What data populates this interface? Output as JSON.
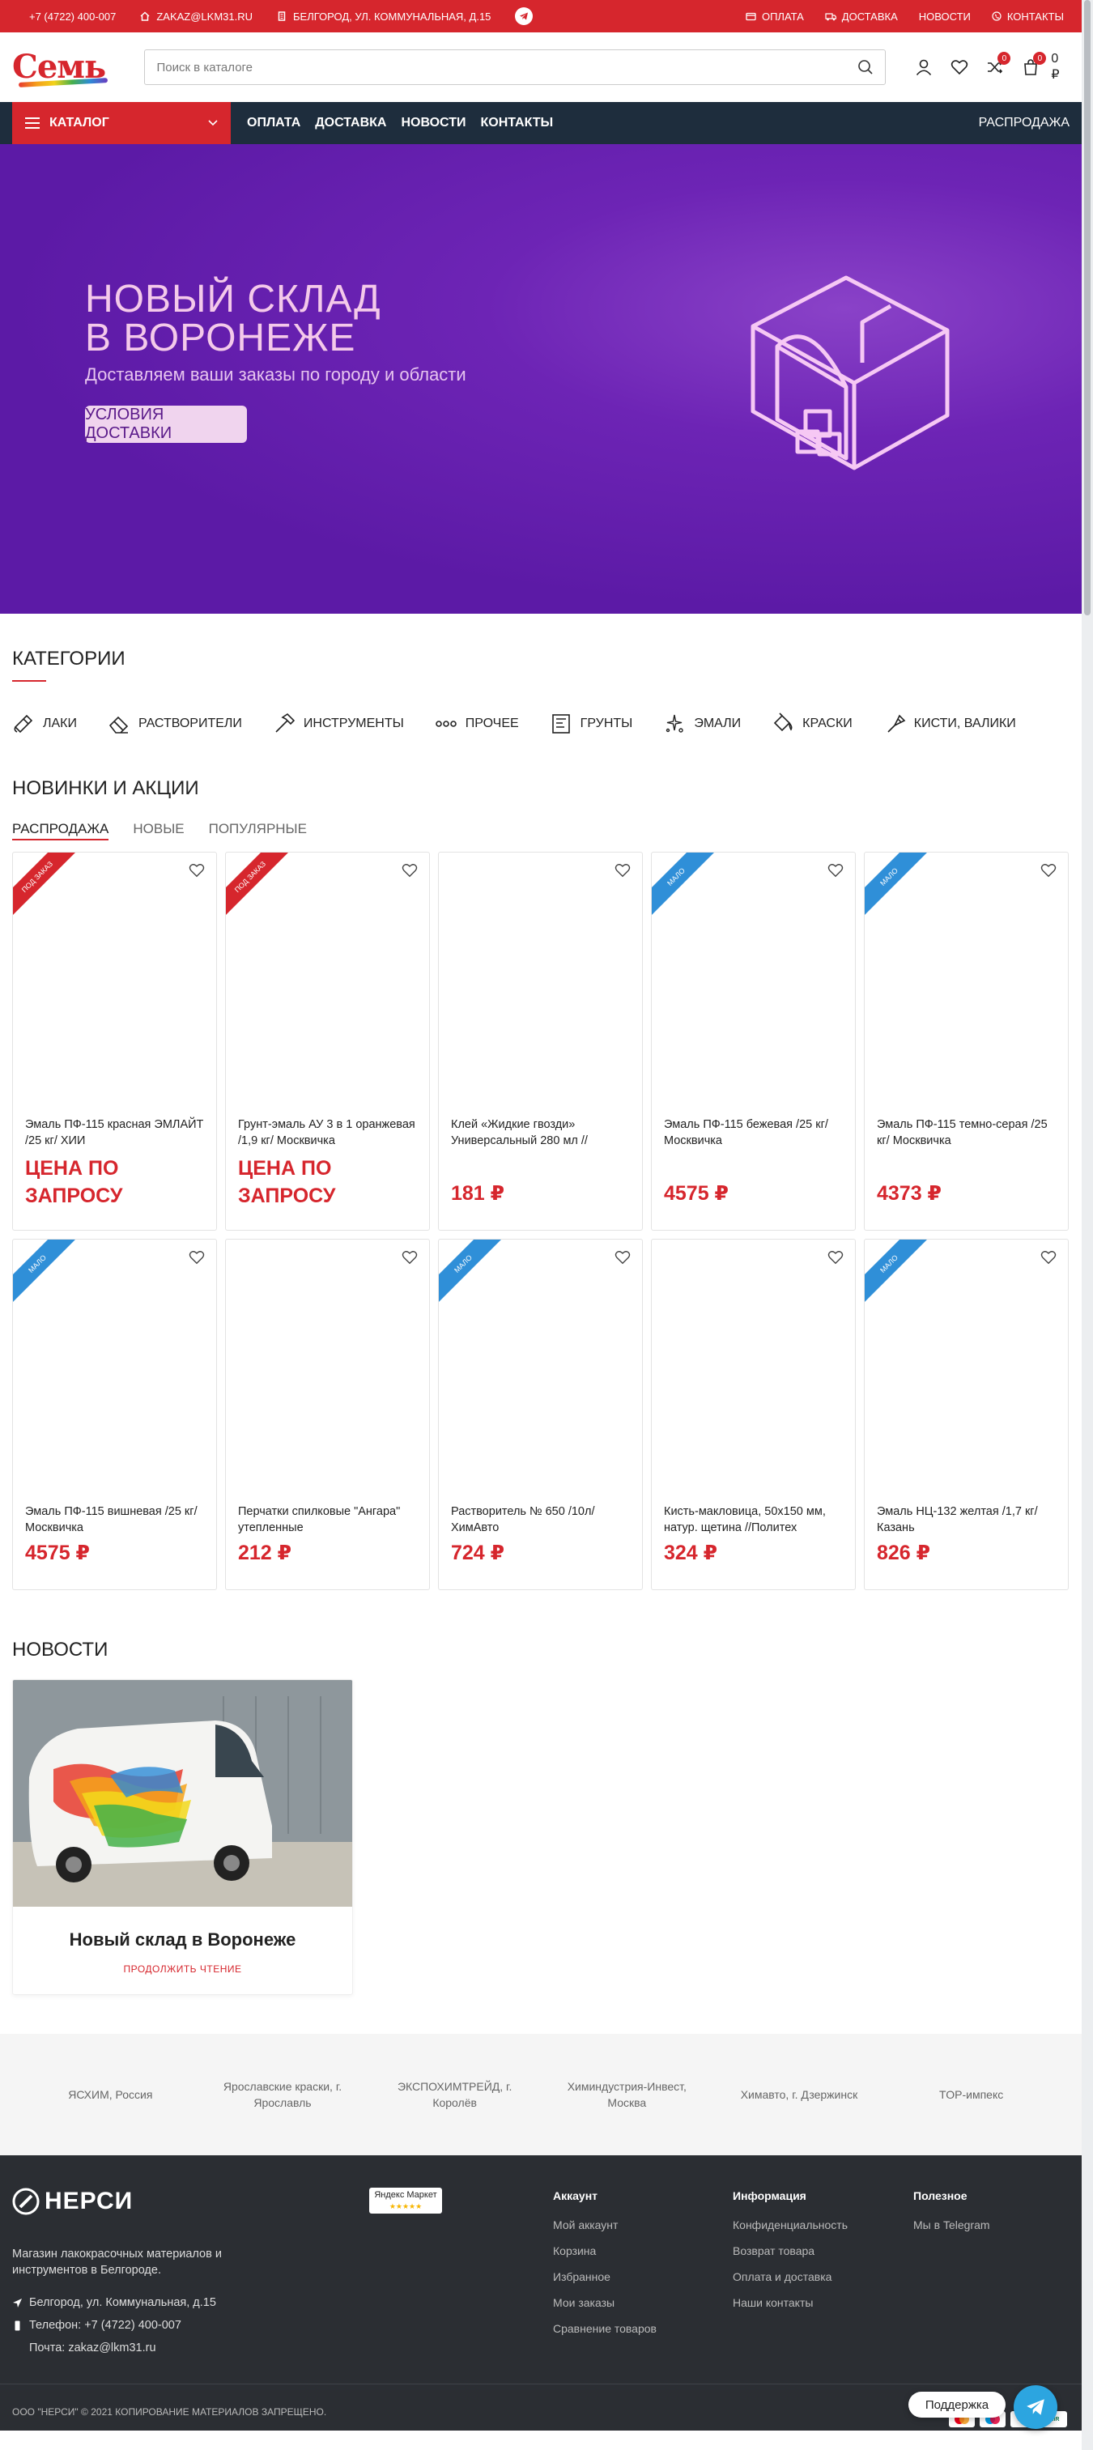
{
  "topbar": {
    "phone": "+7 (4722) 400-007",
    "email": "ZAKAZ@LKM31.RU",
    "address": "БЕЛГОРОД, УЛ. КОММУНАЛЬНАЯ, Д.15",
    "links": [
      "ОПЛАТА",
      "ДОСТАВКА",
      "НОВОСТИ",
      "КОНТАКТЫ"
    ]
  },
  "header": {
    "logo_text": "Семь",
    "search_placeholder": "Поиск в каталоге",
    "wishlist_count": "0",
    "compare_count": "0",
    "cart_count": "0",
    "cart_total": "0 ₽"
  },
  "nav": {
    "catalog_label": "КАТАЛОГ",
    "links": [
      "ОПЛАТА",
      "ДОСТАВКА",
      "НОВОСТИ",
      "КОНТАКТЫ"
    ],
    "sale_label": "РАСПРОДАЖА"
  },
  "hero": {
    "title_line1": "НОВЫЙ СКЛАД",
    "title_line2": "В ВОРОНЕЖЕ",
    "subtitle": "Доставляем ваши заказы по городу и области",
    "button_label": "УСЛОВИЯ ДОСТАВКИ"
  },
  "categories": {
    "heading": "КАТЕГОРИИ",
    "items": [
      {
        "label": "ЛАКИ",
        "icon": "brush-tray-icon"
      },
      {
        "label": "РАСТВОРИТЕЛИ",
        "icon": "eraser-icon"
      },
      {
        "label": "ИНСТРУМЕНТЫ",
        "icon": "hammer-icon"
      },
      {
        "label": "ПРОЧЕЕ",
        "icon": "dots-icon"
      },
      {
        "label": "ГРУНТЫ",
        "icon": "primer-icon"
      },
      {
        "label": "ЭМАЛИ",
        "icon": "sparkle-icon"
      },
      {
        "label": "КРАСКИ",
        "icon": "paint-bucket-icon"
      },
      {
        "label": "КИСТИ, ВАЛИКИ",
        "icon": "roller-icon"
      }
    ]
  },
  "products": {
    "heading": "НОВИНКИ И АКЦИИ",
    "tabs": [
      "РАСПРОДАЖА",
      "НОВЫЕ",
      "ПОПУЛЯРНЫЕ"
    ],
    "items": [
      {
        "title": "Эмаль ПФ-115 красная ЭМЛАЙТ /25 кг/ ХИИ",
        "price": "ЦЕНА ПО ЗАПРОСУ",
        "badge": "ПОД ЗАКАЗ",
        "badge_color": "#d6262d"
      },
      {
        "title": "Грунт-эмаль АУ 3 в 1 оранжевая /1,9 кг/ Москвичка",
        "price": "ЦЕНА ПО ЗАПРОСУ",
        "badge": "ПОД ЗАКАЗ",
        "badge_color": "#d6262d"
      },
      {
        "title": "Клей «Жидкие гвозди» Универсальный 280 мл //",
        "price": "181 ₽",
        "badge": "",
        "badge_color": ""
      },
      {
        "title": "Эмаль ПФ-115 бежевая /25 кг/ Москвичка",
        "price": "4575 ₽",
        "badge": "МАЛО",
        "badge_color": "#2f8fd8"
      },
      {
        "title": "Эмаль ПФ-115 темно-серая /25 кг/ Москвичка",
        "price": "4373 ₽",
        "badge": "МАЛО",
        "badge_color": "#2f8fd8"
      },
      {
        "title": "Эмаль ПФ-115 вишневая /25 кг/ Москвичка",
        "price": "4575 ₽",
        "badge": "МАЛО",
        "badge_color": "#2f8fd8"
      },
      {
        "title": "Перчатки спилковые \"Ангара\" утепленные",
        "price": "212 ₽",
        "badge": "",
        "badge_color": ""
      },
      {
        "title": "Растворитель № 650 /10л/ ХимАвто",
        "price": "724 ₽",
        "badge": "МАЛО",
        "badge_color": "#2f8fd8"
      },
      {
        "title": "Кисть-макловица, 50х150 мм, натур. щетина //Политех",
        "price": "324 ₽",
        "badge": "",
        "badge_color": ""
      },
      {
        "title": "Эмаль НЦ-132 желтая /1,7 кг/ Казань",
        "price": "826 ₽",
        "badge": "МАЛО",
        "badge_color": "#2f8fd8"
      }
    ]
  },
  "news": {
    "heading": "НОВОСТИ",
    "title": "Новый склад в Воронеже",
    "more_label": "ПРОДОЛЖИТЬ ЧТЕНИЕ"
  },
  "brands": [
    "ЯСХИМ, Россия",
    "Ярославские краски, г. Ярославль",
    "ЭКСПОХИМТРЕЙД, г. Королёв",
    "Химиндустрия-Инвест, Москва",
    "Химавто, г. Дзержинск",
    "TOP-импекс"
  ],
  "footer": {
    "logo_text": "НЕРСИ",
    "description": "Магазин лакокрасочных материалов и инструментов в Белгороде.",
    "address": "Белгород, ул. Коммунальная, д.15",
    "phone": "Телефон: +7 (4722) 400-007",
    "email": "Почта: zakaz@lkm31.ru",
    "ym_label": "Яндекс Маркет",
    "col_account": {
      "title": "Аккаунт",
      "links": [
        "Мой аккаунт",
        "Корзина",
        "Избранное",
        "Мои заказы",
        "Сравнение товаров"
      ]
    },
    "col_info": {
      "title": "Информация",
      "links": [
        "Конфиденциальность",
        "Возврат товара",
        "Оплата и доставка",
        "Наши контакты"
      ]
    },
    "col_useful": {
      "title": "Полезное",
      "links": [
        "Мы в Telegram"
      ]
    },
    "copyright_prefix": "ООО \"НЕРСИ\"",
    "copyright_text": "2021 КОПИРОВАНИЕ МАТЕРИАЛОВ ЗАПРЕЩЕНО.",
    "payments": [
      "MC",
      "Maestro",
      "VISA",
      "MIR"
    ]
  },
  "widget": {
    "support_label": "Поддержка"
  }
}
